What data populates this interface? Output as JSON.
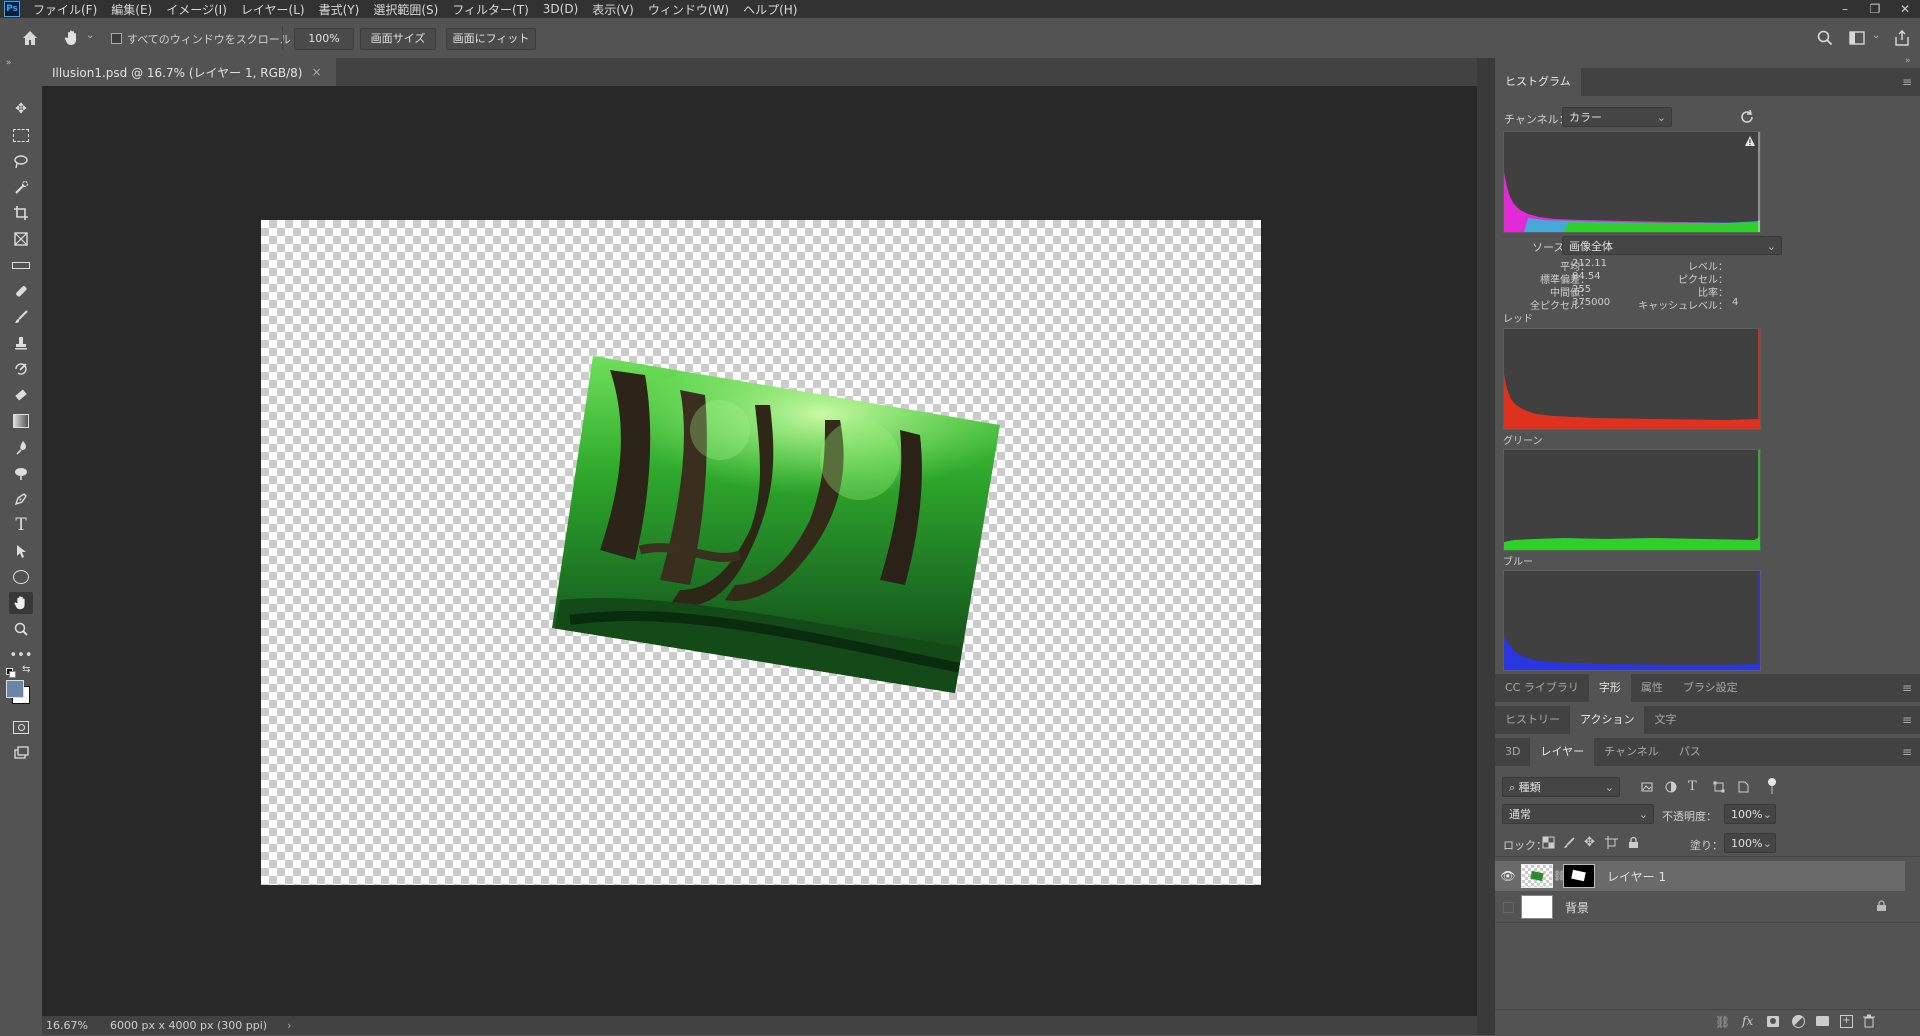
{
  "app": {
    "logo": "Ps"
  },
  "menu": [
    "ファイル(F)",
    "編集(E)",
    "イメージ(I)",
    "レイヤー(L)",
    "書式(Y)",
    "選択範囲(S)",
    "フィルター(T)",
    "3D(D)",
    "表示(V)",
    "ウィンドウ(W)",
    "ヘルプ(H)"
  ],
  "window_controls": {
    "minimize": "–",
    "restore": "❐",
    "close": "✕"
  },
  "options_bar": {
    "scroll_all_label": "すべてのウィンドウをスクロール",
    "zoom_value": "100%",
    "fit_screen_label": "画面サイズ",
    "fill_screen_label": "画面にフィット"
  },
  "document": {
    "tab_title": "Illusion1.psd @ 16.7% (レイヤー 1, RGB/8)",
    "tab_close": "×"
  },
  "status": {
    "zoom": "16.67%",
    "dimensions": "6000 px x 4000 px (300 ppi)",
    "arrow": "›"
  },
  "histogram": {
    "panel_title": "ヒストグラム",
    "channel_label": "チャンネル：",
    "channel_value": "カラー",
    "source_label": "ソース：",
    "source_value": "画像全体",
    "stats": {
      "mean_label": "平均：",
      "mean": "212.11",
      "std_label": "標準偏差：",
      "std": "84.54",
      "median_label": "中間値：",
      "median": "255",
      "pixels_label": "全ピクセル：",
      "pixels": "375000",
      "level_label": "レベル：",
      "count_label": "ピクセル：",
      "percentile_label": "比率：",
      "cache_label": "キャッシュレベル：",
      "cache": "4"
    },
    "channels": [
      "レッド",
      "グリーン",
      "ブルー"
    ],
    "colors": {
      "red": "#e0301e",
      "green": "#2fd02a",
      "blue": "#2a36e0",
      "magenta": "#e22ad6",
      "cyan": "#20c8d8"
    }
  },
  "panel_group1": {
    "tabs": [
      "CC ライブラリ",
      "字形",
      "属性",
      "ブラシ設定"
    ],
    "active": 1
  },
  "panel_group2": {
    "tabs": [
      "ヒストリー",
      "アクション",
      "文字"
    ],
    "active": 1
  },
  "panel_group3": {
    "tabs": [
      "3D",
      "レイヤー",
      "チャンネル",
      "パス"
    ],
    "active": 1
  },
  "layers": {
    "filter_kind": "種類",
    "blend_mode": "通常",
    "opacity_label": "不透明度：",
    "opacity": "100%",
    "lock_label": "ロック：",
    "fill_label": "塗り：",
    "fill": "100%",
    "items": [
      {
        "name": "レイヤー 1",
        "visible": true,
        "selected": true
      },
      {
        "name": "背景",
        "visible": false,
        "locked": true
      }
    ]
  }
}
